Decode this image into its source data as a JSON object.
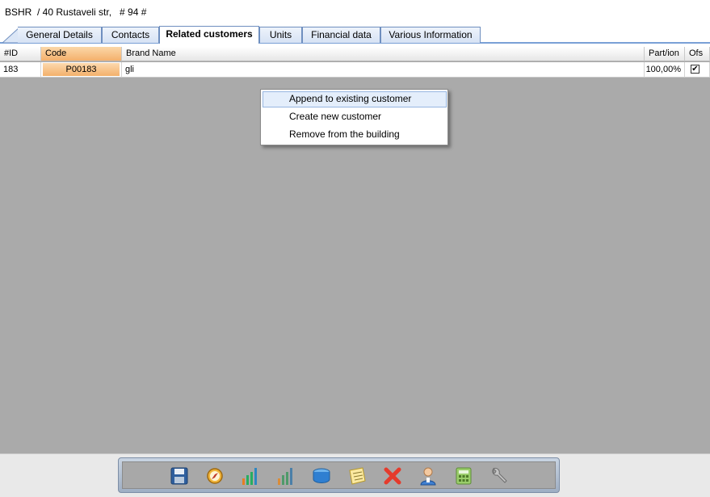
{
  "header": {
    "title": "BSHR  / 40 Rustaveli str,   # 94 #"
  },
  "tabs": [
    {
      "label": "General Details"
    },
    {
      "label": "Contacts"
    },
    {
      "label": "Related customers"
    },
    {
      "label": "Units"
    },
    {
      "label": "Financial data"
    },
    {
      "label": "Various Information"
    }
  ],
  "grid": {
    "columns": {
      "id": "#ID",
      "code": "Code",
      "brand": "Brand Name",
      "partition": "Part/ion",
      "ofs": "Ofs"
    },
    "rows": [
      {
        "id": "183",
        "code": "P00183",
        "brand": "gli",
        "partition": "100,00%",
        "ofs_check": "✔"
      }
    ]
  },
  "context_menu": {
    "items": [
      {
        "label": "Append to existing customer"
      },
      {
        "label": "Create new customer"
      },
      {
        "label": "Remove from the building"
      }
    ]
  },
  "toolbar": {
    "icons": [
      "save-icon",
      "compass-icon",
      "bar-chart-icon",
      "bar-chart-gray-icon",
      "database-icon",
      "notepad-icon",
      "delete-icon",
      "user-icon",
      "calculator-icon",
      "wrench-icon"
    ]
  },
  "colors": {
    "accent": "#7aa0d6",
    "code_highlight": "#f4b06c",
    "grid_background": "#aaaaaa"
  }
}
